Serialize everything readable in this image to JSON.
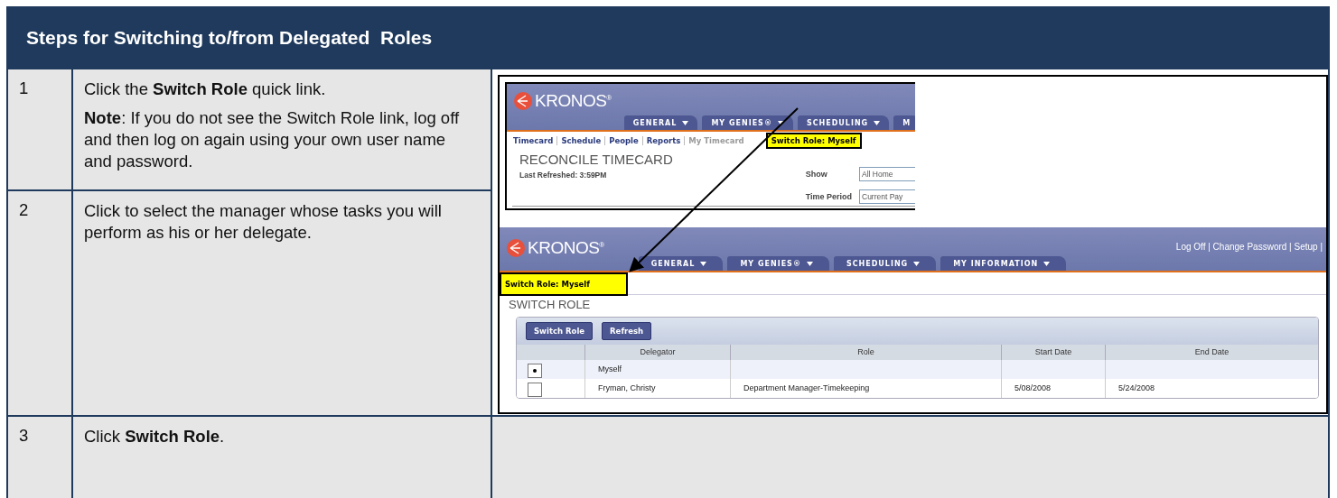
{
  "title": "Steps for Switching to/from Delegated  Roles",
  "steps": [
    {
      "number": "1",
      "paragraphs": [
        "Click the **Switch Role** quick link.",
        "**Note**: If you do not see the Switch Role link, log off and then log on again using your own user name and password."
      ]
    },
    {
      "number": "2",
      "paragraphs": [
        "Click to select the manager whose tasks you will perform as his or her delegate."
      ]
    },
    {
      "number": "3",
      "paragraphs": [
        "Click **Switch Role**."
      ]
    }
  ],
  "screenshot_top": {
    "logo": "KRONOS$^{®}$",
    "tabs": [
      {
        "label": "GENERAL",
        "caret": true
      },
      {
        "label": "MY GENIES®",
        "caret": true
      },
      {
        "label": "SCHEDULING",
        "caret": true
      },
      {
        "label": "M",
        "caret": false
      }
    ],
    "quick_links": [
      {
        "label": "Timecard",
        "disabled": false
      },
      {
        "label": "Schedule",
        "disabled": false
      },
      {
        "label": "People",
        "disabled": false
      },
      {
        "label": "Reports",
        "disabled": false
      },
      {
        "label": "My Timecard",
        "disabled": true
      }
    ],
    "badge": "Switch Role: Myself",
    "page_title": "RECONCILE TIMECARD",
    "refreshed": "Last Refreshed: 3:59PM",
    "fields": [
      {
        "label": "Show",
        "value": "All Home"
      },
      {
        "label": "Time Period",
        "value": "Current Pay"
      }
    ]
  },
  "screenshot_bottom": {
    "logo": "KRONOS$^{®}$",
    "header_links": "Log Off | Change Password | Setup |",
    "tabs": [
      {
        "label": "GENERAL",
        "caret": true
      },
      {
        "label": "MY GENIES®",
        "caret": true
      },
      {
        "label": "SCHEDULING",
        "caret": true
      },
      {
        "label": "MY INFORMATION",
        "caret": true
      }
    ],
    "badge": "Switch Role: Myself",
    "page_title": "SWITCH ROLE",
    "buttons": [
      "Switch Role",
      "Refresh"
    ],
    "columns": [
      "Delegator",
      "Role",
      "Start Date",
      "End Date"
    ],
    "rows": [
      {
        "selected": true,
        "delegator": "Myself"
      },
      {
        "selected": false,
        "delegator": "Fryman, Christy",
        "role": "Department Manager-Timekeeping",
        "start_date": "5/08/2008",
        "end_date": "5/24/2008"
      }
    ]
  }
}
